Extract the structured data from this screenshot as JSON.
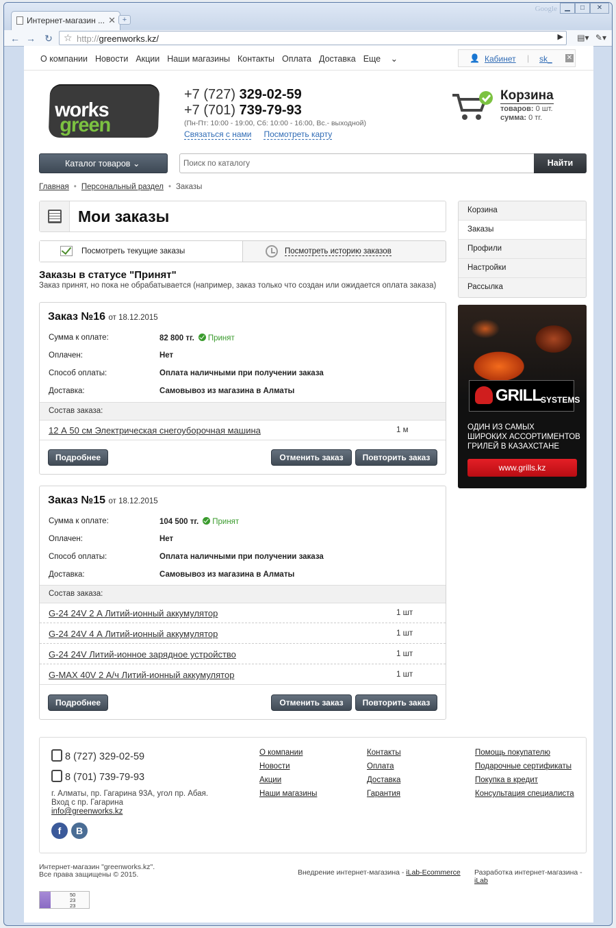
{
  "browser": {
    "tab_title": "Интернет-магазин ...",
    "brand": "Google",
    "url_scheme": "http://",
    "url_host": "greenworks.kz/",
    "new_tab": "+",
    "min": "▁",
    "max": "□",
    "close": "✕"
  },
  "topnav": {
    "links": [
      "О компании",
      "Новости",
      "Акции",
      "Наши магазины",
      "Контакты",
      "Оплата",
      "Доставка"
    ],
    "more": "Еще",
    "cabinet": "Кабинет",
    "lang": "sk_"
  },
  "header": {
    "logo_green": "green",
    "logo_white": "works",
    "phone1_prefix": "+7 (727) ",
    "phone1_num": "329-02-59",
    "phone2_prefix": "+7 (701) ",
    "phone2_num": "739-79-93",
    "hours": "(Пн-Пт: 10:00 - 19:00, Сб: 10:00 - 16:00, Вс.- выходной)",
    "contact_link": "Связаться с нами",
    "map_link": "Посмотреть карту",
    "cart_title": "Корзина",
    "cart_items_label": "товаров:",
    "cart_items_value": "0 шт.",
    "cart_sum_label": "сумма:",
    "cart_sum_value": "0 тг."
  },
  "catalog_button": "Каталог товаров",
  "search": {
    "placeholder": "Поиск по каталогу",
    "button": "Найти"
  },
  "breadcrumbs": [
    "Главная",
    "Персональный раздел",
    "Заказы"
  ],
  "page_title": "Мои заказы",
  "tabs": {
    "current": "Посмотреть текущие заказы",
    "history": "Посмотреть историю заказов"
  },
  "status": {
    "heading": "Заказы в статусе \"Принят\"",
    "description": "Заказ принят, но пока не обрабатывается (например, заказ только что создан или ожидается оплата заказа)"
  },
  "labels": {
    "sum": "Сумма к оплате:",
    "paid": "Оплачен:",
    "payment": "Способ оплаты:",
    "delivery": "Доставка:",
    "composition": "Состав заказа:",
    "details": "Подробнее",
    "cancel": "Отменить заказ",
    "repeat": "Повторить заказ",
    "accepted": "Принят",
    "from": "от"
  },
  "orders": [
    {
      "number": "Заказ №16",
      "date": "18.12.2015",
      "sum": "82 800 тг.",
      "paid": "Нет",
      "payment": "Оплата наличными при получении заказа",
      "delivery": "Самовывоз из магазина в Алматы",
      "items": [
        {
          "name": "12 А 50 см Электрическая снегоуборочная машина",
          "qty": "1 м"
        }
      ]
    },
    {
      "number": "Заказ №15",
      "date": "18.12.2015",
      "sum": "104 500 тг.",
      "paid": "Нет",
      "payment": "Оплата наличными при получении заказа",
      "delivery": "Самовывоз из магазина в Алматы",
      "items": [
        {
          "name": "G-24 24V 2 А Литий-ионный аккумулятор",
          "qty": "1 шт"
        },
        {
          "name": "G-24 24V 4 А Литий-ионный аккумулятор",
          "qty": "1 шт"
        },
        {
          "name": "G-24 24V Литий-ионное зарядное устройство",
          "qty": "1 шт"
        },
        {
          "name": "G-MAX 40V 2 А/ч Литий-ионный аккумулятор",
          "qty": "1 шт"
        }
      ]
    }
  ],
  "sidebar": [
    "Корзина",
    "Заказы",
    "Профили",
    "Настройки",
    "Рассылка"
  ],
  "banner": {
    "brand_big": "GRILL",
    "brand_small": "SYSTEMS",
    "line1": "ОДИН ИЗ САМЫХ",
    "line2": "ШИРОКИХ АССОРТИМЕНТОВ",
    "line3": "ГРИЛЕЙ В КАЗАХСТАНЕ",
    "button": "www.grills.kz"
  },
  "footer": {
    "phone1": "8 (727) 329-02-59",
    "phone2": "8 (701) 739-79-93",
    "address1": "г. Алматы, пр. Гагарина 93А, угол пр. Абая.",
    "address2": "Вход с пр. Гагарина",
    "email": "info@greenworks.kz",
    "fb": "f",
    "vk": "B",
    "col1": [
      "О компании",
      "Новости",
      "Акции",
      "Наши магазины"
    ],
    "col2": [
      "Контакты",
      "Оплата",
      "Доставка",
      "Гарантия"
    ],
    "col3": [
      "Помощь покупателю",
      "Подарочные сертификаты",
      "Покупка в кредит",
      "Консультация специалиста"
    ]
  },
  "bottom": {
    "copy1": "Интернет-магазин \"greenworks.kz\".",
    "copy2": "Все права защищены © 2015.",
    "impl_text": "Внедрение интернет-магазина - ",
    "impl_link": "iLab-Ecommerce",
    "dev_text": "Разработка интернет-магазина - ",
    "dev_link": "iLab"
  },
  "counter": [
    "50",
    "23",
    "23"
  ],
  "colors": {
    "green": "#7cc241",
    "accent_link": "#2f6bb5",
    "status_green": "#3a9b2d",
    "banner_red": "#e41f26"
  }
}
